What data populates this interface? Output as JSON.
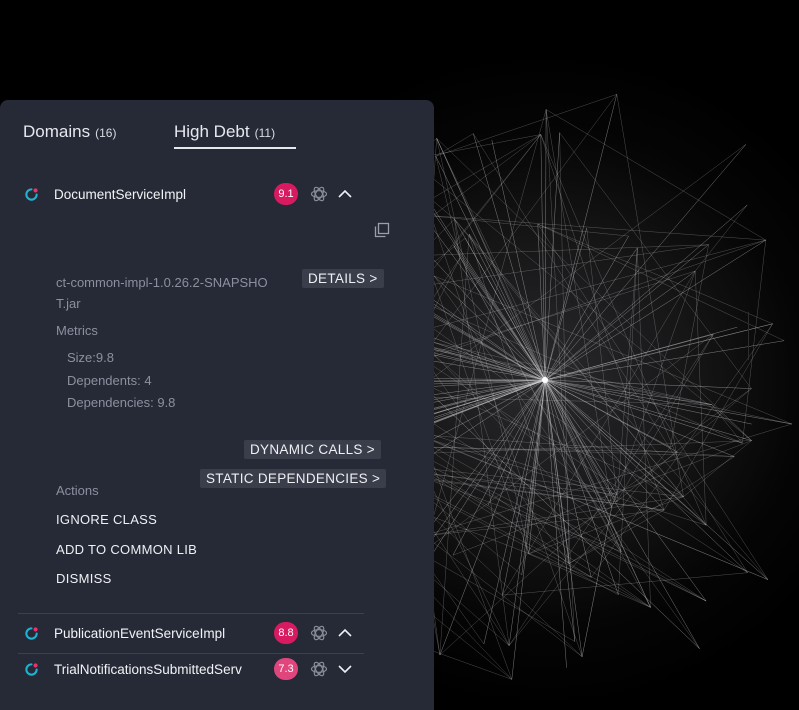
{
  "tabs": [
    {
      "label": "Domains",
      "count": "(16)"
    },
    {
      "label": "High Debt",
      "count": "(11)"
    }
  ],
  "expanded": {
    "name": "DocumentServiceImpl",
    "score": "9.1",
    "jar": "ct-common-impl-1.0.26.2-SNAPSHOT.jar",
    "details_label": "DETAILS >",
    "metrics_title": "Metrics",
    "metrics": [
      "Size:9.8",
      "Dependents: 4",
      "Dependencies: 9.8"
    ],
    "dynamic_calls_label": "DYNAMIC CALLS >",
    "static_deps_label": "STATIC DEPENDENCIES >",
    "actions_title": "Actions",
    "actions": [
      "IGNORE CLASS",
      "ADD TO COMMON LIB",
      "DISMISS"
    ]
  },
  "rows": [
    {
      "name": "PublicationEventServiceImpl",
      "score": "8.8"
    },
    {
      "name": "TrialNotificationsSubmittedServ",
      "score": "7.3"
    }
  ],
  "colors": {
    "panel": "#262a36",
    "badge_high": "#d81b60",
    "badge_mid": "#e0467c",
    "ring": "#1fb3d1",
    "ring_dot": "#e8336e"
  },
  "icons": [
    "refresh-ring-icon",
    "ai-assistant-icon",
    "chevron-up-icon",
    "chevron-down-icon",
    "copy-icon"
  ]
}
